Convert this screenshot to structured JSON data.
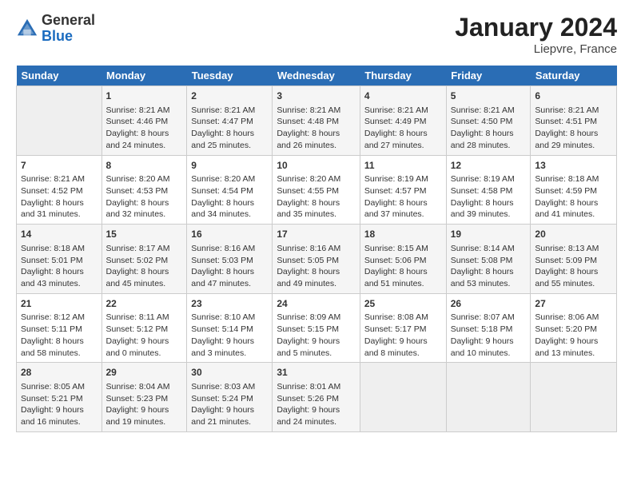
{
  "header": {
    "logo_general": "General",
    "logo_blue": "Blue",
    "month": "January 2024",
    "location": "Liepvre, France"
  },
  "days_of_week": [
    "Sunday",
    "Monday",
    "Tuesday",
    "Wednesday",
    "Thursday",
    "Friday",
    "Saturday"
  ],
  "weeks": [
    [
      {
        "num": "",
        "info": ""
      },
      {
        "num": "1",
        "info": "Sunrise: 8:21 AM\nSunset: 4:46 PM\nDaylight: 8 hours\nand 24 minutes."
      },
      {
        "num": "2",
        "info": "Sunrise: 8:21 AM\nSunset: 4:47 PM\nDaylight: 8 hours\nand 25 minutes."
      },
      {
        "num": "3",
        "info": "Sunrise: 8:21 AM\nSunset: 4:48 PM\nDaylight: 8 hours\nand 26 minutes."
      },
      {
        "num": "4",
        "info": "Sunrise: 8:21 AM\nSunset: 4:49 PM\nDaylight: 8 hours\nand 27 minutes."
      },
      {
        "num": "5",
        "info": "Sunrise: 8:21 AM\nSunset: 4:50 PM\nDaylight: 8 hours\nand 28 minutes."
      },
      {
        "num": "6",
        "info": "Sunrise: 8:21 AM\nSunset: 4:51 PM\nDaylight: 8 hours\nand 29 minutes."
      }
    ],
    [
      {
        "num": "7",
        "info": ""
      },
      {
        "num": "8",
        "info": "Sunrise: 8:20 AM\nSunset: 4:53 PM\nDaylight: 8 hours\nand 32 minutes."
      },
      {
        "num": "9",
        "info": "Sunrise: 8:20 AM\nSunset: 4:54 PM\nDaylight: 8 hours\nand 34 minutes."
      },
      {
        "num": "10",
        "info": "Sunrise: 8:20 AM\nSunset: 4:55 PM\nDaylight: 8 hours\nand 35 minutes."
      },
      {
        "num": "11",
        "info": "Sunrise: 8:19 AM\nSunset: 4:57 PM\nDaylight: 8 hours\nand 37 minutes."
      },
      {
        "num": "12",
        "info": "Sunrise: 8:19 AM\nSunset: 4:58 PM\nDaylight: 8 hours\nand 39 minutes."
      },
      {
        "num": "13",
        "info": "Sunrise: 8:18 AM\nSunset: 4:59 PM\nDaylight: 8 hours\nand 41 minutes."
      }
    ],
    [
      {
        "num": "14",
        "info": "Sunrise: 8:18 AM\nSunset: 5:01 PM\nDaylight: 8 hours\nand 43 minutes."
      },
      {
        "num": "15",
        "info": "Sunrise: 8:17 AM\nSunset: 5:02 PM\nDaylight: 8 hours\nand 45 minutes."
      },
      {
        "num": "16",
        "info": "Sunrise: 8:16 AM\nSunset: 5:03 PM\nDaylight: 8 hours\nand 47 minutes."
      },
      {
        "num": "17",
        "info": "Sunrise: 8:16 AM\nSunset: 5:05 PM\nDaylight: 8 hours\nand 49 minutes."
      },
      {
        "num": "18",
        "info": "Sunrise: 8:15 AM\nSunset: 5:06 PM\nDaylight: 8 hours\nand 51 minutes."
      },
      {
        "num": "19",
        "info": "Sunrise: 8:14 AM\nSunset: 5:08 PM\nDaylight: 8 hours\nand 53 minutes."
      },
      {
        "num": "20",
        "info": "Sunrise: 8:13 AM\nSunset: 5:09 PM\nDaylight: 8 hours\nand 55 minutes."
      }
    ],
    [
      {
        "num": "21",
        "info": "Sunrise: 8:12 AM\nSunset: 5:11 PM\nDaylight: 8 hours\nand 58 minutes."
      },
      {
        "num": "22",
        "info": "Sunrise: 8:11 AM\nSunset: 5:12 PM\nDaylight: 9 hours\nand 0 minutes."
      },
      {
        "num": "23",
        "info": "Sunrise: 8:10 AM\nSunset: 5:14 PM\nDaylight: 9 hours\nand 3 minutes."
      },
      {
        "num": "24",
        "info": "Sunrise: 8:09 AM\nSunset: 5:15 PM\nDaylight: 9 hours\nand 5 minutes."
      },
      {
        "num": "25",
        "info": "Sunrise: 8:08 AM\nSunset: 5:17 PM\nDaylight: 9 hours\nand 8 minutes."
      },
      {
        "num": "26",
        "info": "Sunrise: 8:07 AM\nSunset: 5:18 PM\nDaylight: 9 hours\nand 10 minutes."
      },
      {
        "num": "27",
        "info": "Sunrise: 8:06 AM\nSunset: 5:20 PM\nDaylight: 9 hours\nand 13 minutes."
      }
    ],
    [
      {
        "num": "28",
        "info": "Sunrise: 8:05 AM\nSunset: 5:21 PM\nDaylight: 9 hours\nand 16 minutes."
      },
      {
        "num": "29",
        "info": "Sunrise: 8:04 AM\nSunset: 5:23 PM\nDaylight: 9 hours\nand 19 minutes."
      },
      {
        "num": "30",
        "info": "Sunrise: 8:03 AM\nSunset: 5:24 PM\nDaylight: 9 hours\nand 21 minutes."
      },
      {
        "num": "31",
        "info": "Sunrise: 8:01 AM\nSunset: 5:26 PM\nDaylight: 9 hours\nand 24 minutes."
      },
      {
        "num": "",
        "info": ""
      },
      {
        "num": "",
        "info": ""
      },
      {
        "num": "",
        "info": ""
      }
    ]
  ]
}
